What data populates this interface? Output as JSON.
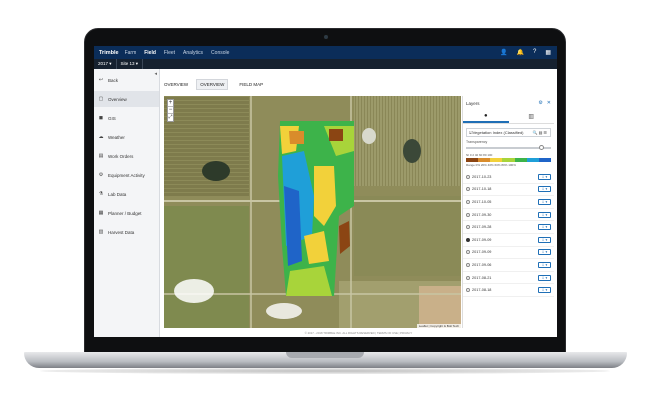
{
  "app": {
    "brand": "Trimble",
    "nav": [
      "Farm",
      "Field",
      "Fleet",
      "Analytics",
      "Console"
    ],
    "active_nav": "Field",
    "year_selector": "2017 ▾",
    "site_selector": "Site 13 ▾"
  },
  "sidebar": {
    "items": [
      {
        "label": "Back",
        "icon": "back-arrow-icon",
        "glyph": "↩"
      },
      {
        "label": "Overview",
        "icon": "overview-icon",
        "glyph": "▢"
      },
      {
        "label": "GIS",
        "icon": "gis-icon",
        "glyph": "◼"
      },
      {
        "label": "Weather",
        "icon": "weather-icon",
        "glyph": "☁"
      },
      {
        "label": "Work Orders",
        "icon": "work-orders-icon",
        "glyph": "▤"
      },
      {
        "label": "Equipment Activity",
        "icon": "equipment-icon",
        "glyph": "⚙"
      },
      {
        "label": "Lab Data",
        "icon": "lab-icon",
        "glyph": "⚗"
      },
      {
        "label": "Planner / Budget",
        "icon": "planner-icon",
        "glyph": "▦"
      },
      {
        "label": "Harvest Data",
        "icon": "harvest-icon",
        "glyph": "▥"
      }
    ]
  },
  "main": {
    "section_title": "OVERVIEW",
    "tabs": [
      "OVERVIEW",
      "FIELD MAP"
    ],
    "attribution": "Leaflet | Copyright & Bolt Tech",
    "footer": "© 2017 - 2018 TRIMBLE INC. ALL RIGHTS RESERVED | TERMS OF USE | PRIVACY"
  },
  "layers": {
    "title": "Layers",
    "layer_name": "Vegetation Index (Classified)",
    "transparency_label": "Transparency",
    "transparency_value": 0.86,
    "legend_values": "NI   0   2   40   60   80   100",
    "legend_range": "Range  0%  20%  40%  60%  80%  100%",
    "legend_colors": [
      "#8b4513",
      "#d98c2b",
      "#f2d13a",
      "#a8d43a",
      "#3db34a",
      "#1f9fd8",
      "#1f64c8"
    ],
    "dates": [
      {
        "label": "2017-10-23",
        "selected": false
      },
      {
        "label": "2017-10-18",
        "selected": false
      },
      {
        "label": "2017-10-05",
        "selected": false
      },
      {
        "label": "2017-09-30",
        "selected": false
      },
      {
        "label": "2017-09-28",
        "selected": false
      },
      {
        "label": "2017-09-09",
        "selected": true
      },
      {
        "label": "2017-09-09",
        "selected": false
      },
      {
        "label": "2017-09-06",
        "selected": false
      },
      {
        "label": "2017-08-21",
        "selected": false
      },
      {
        "label": "2017-08-18",
        "selected": false
      }
    ],
    "date_button_label": "⇩ ▾"
  }
}
